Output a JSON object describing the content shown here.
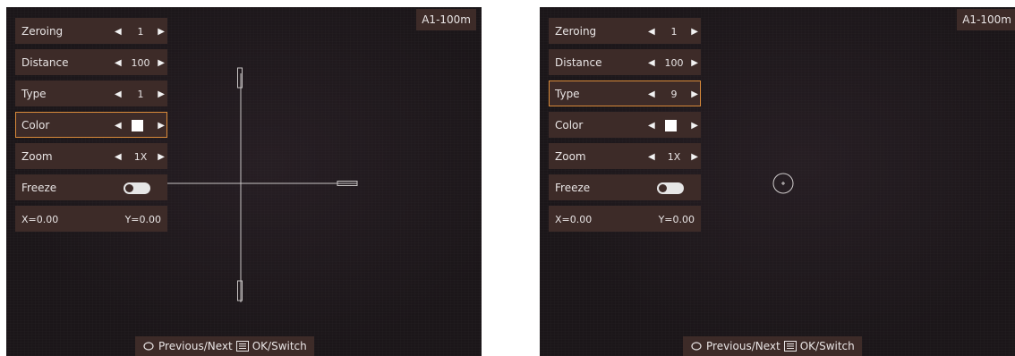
{
  "left_screen": {
    "profile": "A1-100m",
    "menu": {
      "zeroing": {
        "label": "Zeroing",
        "value": "1"
      },
      "distance": {
        "label": "Distance",
        "value": "100"
      },
      "type": {
        "label": "Type",
        "value": "1"
      },
      "color": {
        "label": "Color"
      },
      "zoom": {
        "label": "Zoom",
        "value": "1X"
      },
      "freeze": {
        "label": "Freeze"
      },
      "x": "X=0.00",
      "y": "Y=0.00"
    },
    "selected": "color",
    "hint": {
      "prev_next": "Previous/Next",
      "ok_switch": "OK/Switch"
    },
    "reticle": "type-1-crosshair"
  },
  "right_screen": {
    "profile": "A1-100m",
    "menu": {
      "zeroing": {
        "label": "Zeroing",
        "value": "1"
      },
      "distance": {
        "label": "Distance",
        "value": "100"
      },
      "type": {
        "label": "Type",
        "value": "9"
      },
      "color": {
        "label": "Color"
      },
      "zoom": {
        "label": "Zoom",
        "value": "1X"
      },
      "freeze": {
        "label": "Freeze"
      },
      "x": "X=0.00",
      "y": "Y=0.00"
    },
    "selected": "type",
    "hint": {
      "prev_next": "Previous/Next",
      "ok_switch": "OK/Switch"
    },
    "reticle": "type-9-circle-cross"
  },
  "colors": {
    "panel": "#3d2b28",
    "highlight": "#d98a3a",
    "screen": "#1b1619",
    "text": "#e8e4e4"
  }
}
